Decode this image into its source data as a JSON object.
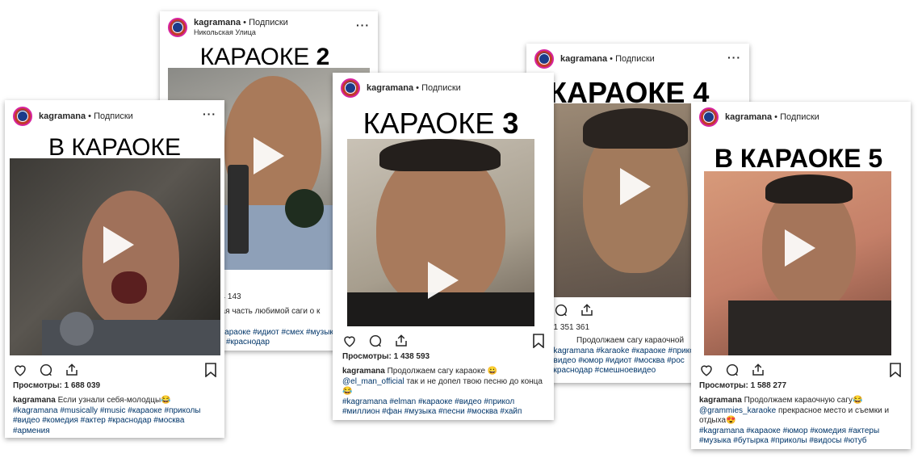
{
  "posts": [
    {
      "username": "kagramana",
      "follow_label": "• Подписки",
      "title": "В КАРАОКЕ",
      "views_label": "Просмотры:",
      "views_count": "1 688 039",
      "caption_user": "kagramana",
      "caption_text": "Если узнали себя-молодцы😂",
      "hashtags": "#kagramana #musically #music #караоке #приколы #видео #комедия #актер #краснодар #москва #армения"
    },
    {
      "username": "kagramana",
      "follow_label": "• Подписки",
      "location": "Никольская Улица",
      "title_text": "КАРАОКЕ",
      "title_num": "2",
      "views_count_partial": "34 143",
      "caption_partial": "рая часть любимой саги о к",
      "hashtags_partial_1": "#караоке #идиот #смех #музык",
      "hashtags_partial_2": "#краснодар"
    },
    {
      "username": "kagramana",
      "follow_label": "• Подписки",
      "title_text": "КАРАОКЕ",
      "title_num": "3",
      "views_label": "Просмотры:",
      "views_count": "1 438 593",
      "caption_user": "kagramana",
      "caption_text": "Продолжаем сагу караоке 😀",
      "mention": "@el_man_official",
      "caption_text_2": "так и не допел твою песню до конца 😂",
      "hashtags": "#kagramana #elman #караоке #видео #прикол #миллион #фан #музыка #песни #москва #хайп"
    },
    {
      "username": "kagramana",
      "follow_label": "• Подписки",
      "title": "КАРАОКЕ 4",
      "views_count_partial": ": 1 351 361",
      "caption_partial": "Продолжаем сагу караочной",
      "hashtags_partial_1": "#kagramana #karaoke #караоке #приколы",
      "hashtags_partial_2": "#видео #юмор #идиот #москва #рос",
      "hashtags_partial_3": "#краснодар #смешноевидео"
    },
    {
      "username": "kagramana",
      "follow_label": "• Подписки",
      "title_text": "В КАРАОКЕ",
      "title_num": "5",
      "views_label": "Просмотры:",
      "views_count": "1 588 277",
      "caption_user": "kagramana",
      "caption_text": "Продолжаем караочную сагу😂",
      "mention": "@grammies_karaoke",
      "caption_text_2": "прекрасное место и съемки и отдыха😍",
      "hashtags": "#kagramana #караоке #юмор #комедия #актеры #музыка #бутырка #приколы #видосы #ютуб"
    }
  ],
  "icons": [
    "heart-icon",
    "comment-icon",
    "share-icon",
    "bookmark-icon",
    "play-icon",
    "more-icon"
  ],
  "colors": {
    "hashtag": "#003569",
    "text": "#262626",
    "avatar_ring": "#d6249f"
  }
}
